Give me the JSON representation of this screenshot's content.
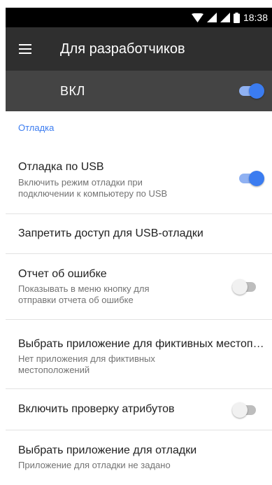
{
  "status_bar": {
    "time": "18:38",
    "icons": [
      "wifi-icon",
      "signal-icon",
      "signal-icon",
      "battery-icon"
    ]
  },
  "app_bar": {
    "title": "Для разработчиков",
    "menu_icon": "hamburger-menu-icon"
  },
  "master_switch": {
    "label": "ВКЛ",
    "checked": true
  },
  "section": {
    "header": "Отладка"
  },
  "settings": {
    "usb_debugging": {
      "title": "Отладка по USB",
      "summary_line1": "Включить режим отладки при",
      "summary_line2": "подключении к компьютеру по USB",
      "checked": true
    },
    "revoke_usb": {
      "title": "Запретить доступ для USB-отладки"
    },
    "bug_report": {
      "title": "Отчет об ошибке",
      "summary_line1": "Показывать в меню кнопку для",
      "summary_line2": "отправки отчета об ошибке",
      "checked": false
    },
    "mock_location": {
      "title": "Выбрать приложение для фиктивных местоположений",
      "summary_line1": "Нет приложения для фиктивных",
      "summary_line2": "местоположений"
    },
    "attribute_check": {
      "title": "Включить проверку атрибутов",
      "checked": false
    },
    "debug_app": {
      "title": "Выбрать приложение для отладки",
      "summary": "Приложение для отладки не задано"
    }
  },
  "colors": {
    "accent": "#3b7cf0",
    "app_bar": "#2f2f2f",
    "master_bar": "#444444"
  }
}
